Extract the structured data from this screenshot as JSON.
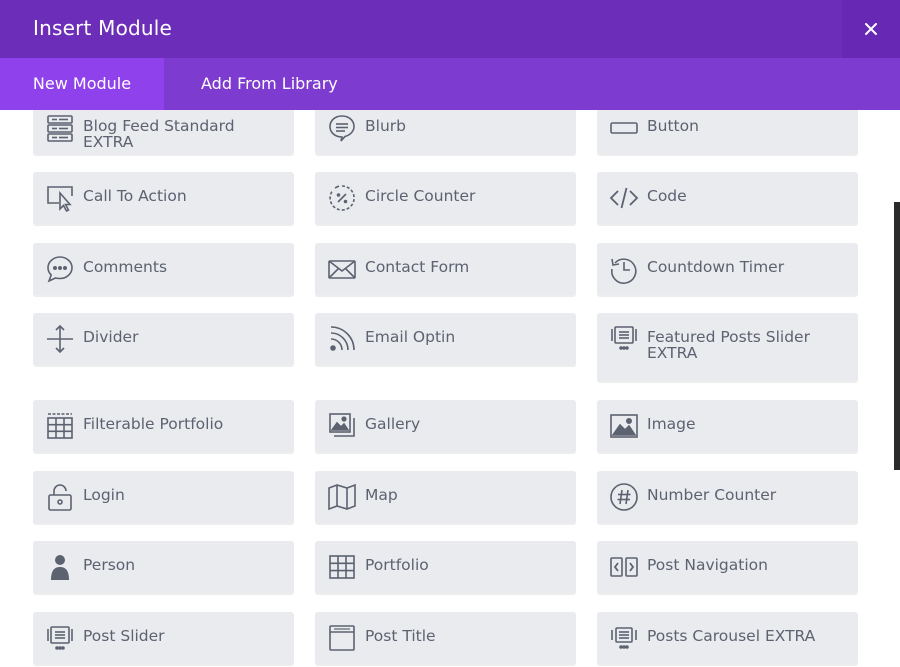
{
  "header": {
    "title": "Insert Module",
    "close_symbol": "×"
  },
  "tabs": [
    {
      "label": "New Module",
      "active": true
    },
    {
      "label": "Add From Library",
      "active": false
    }
  ],
  "colors": {
    "header_bg": "#6c2eb9",
    "tabbar_bg": "#7e3bd0",
    "active_tab_bg": "#8f42ec",
    "module_bg": "#e9ebef",
    "module_text": "#5d6270"
  },
  "modules": [
    {
      "label": "Blog Feed Standard EXTRA",
      "icon": "blog-feed-icon"
    },
    {
      "label": "Blurb",
      "icon": "speech-bubble-icon"
    },
    {
      "label": "Button",
      "icon": "button-icon"
    },
    {
      "label": "Call To Action",
      "icon": "cursor-on-screen-icon"
    },
    {
      "label": "Circle Counter",
      "icon": "circle-counter-icon"
    },
    {
      "label": "Code",
      "icon": "code-icon"
    },
    {
      "label": "Comments",
      "icon": "comment-bubble-icon"
    },
    {
      "label": "Contact Form",
      "icon": "envelope-icon"
    },
    {
      "label": "Countdown Timer",
      "icon": "history-clock-icon"
    },
    {
      "label": "Divider",
      "icon": "vertical-resize-icon"
    },
    {
      "label": "Email Optin",
      "icon": "rss-icon"
    },
    {
      "label": "Featured Posts Slider EXTRA",
      "icon": "featured-slider-icon"
    },
    {
      "label": "Filterable Portfolio",
      "icon": "filter-grid-icon"
    },
    {
      "label": "Gallery",
      "icon": "gallery-icon"
    },
    {
      "label": "Image",
      "icon": "image-icon"
    },
    {
      "label": "Login",
      "icon": "lock-icon"
    },
    {
      "label": "Map",
      "icon": "map-icon"
    },
    {
      "label": "Number Counter",
      "icon": "hash-circle-icon"
    },
    {
      "label": "Person",
      "icon": "person-icon"
    },
    {
      "label": "Portfolio",
      "icon": "grid-icon"
    },
    {
      "label": "Post Navigation",
      "icon": "post-navigation-icon"
    },
    {
      "label": "Post Slider",
      "icon": "post-slider-icon"
    },
    {
      "label": "Post Title",
      "icon": "post-title-icon"
    },
    {
      "label": "Posts Carousel EXTRA",
      "icon": "carousel-icon"
    }
  ]
}
